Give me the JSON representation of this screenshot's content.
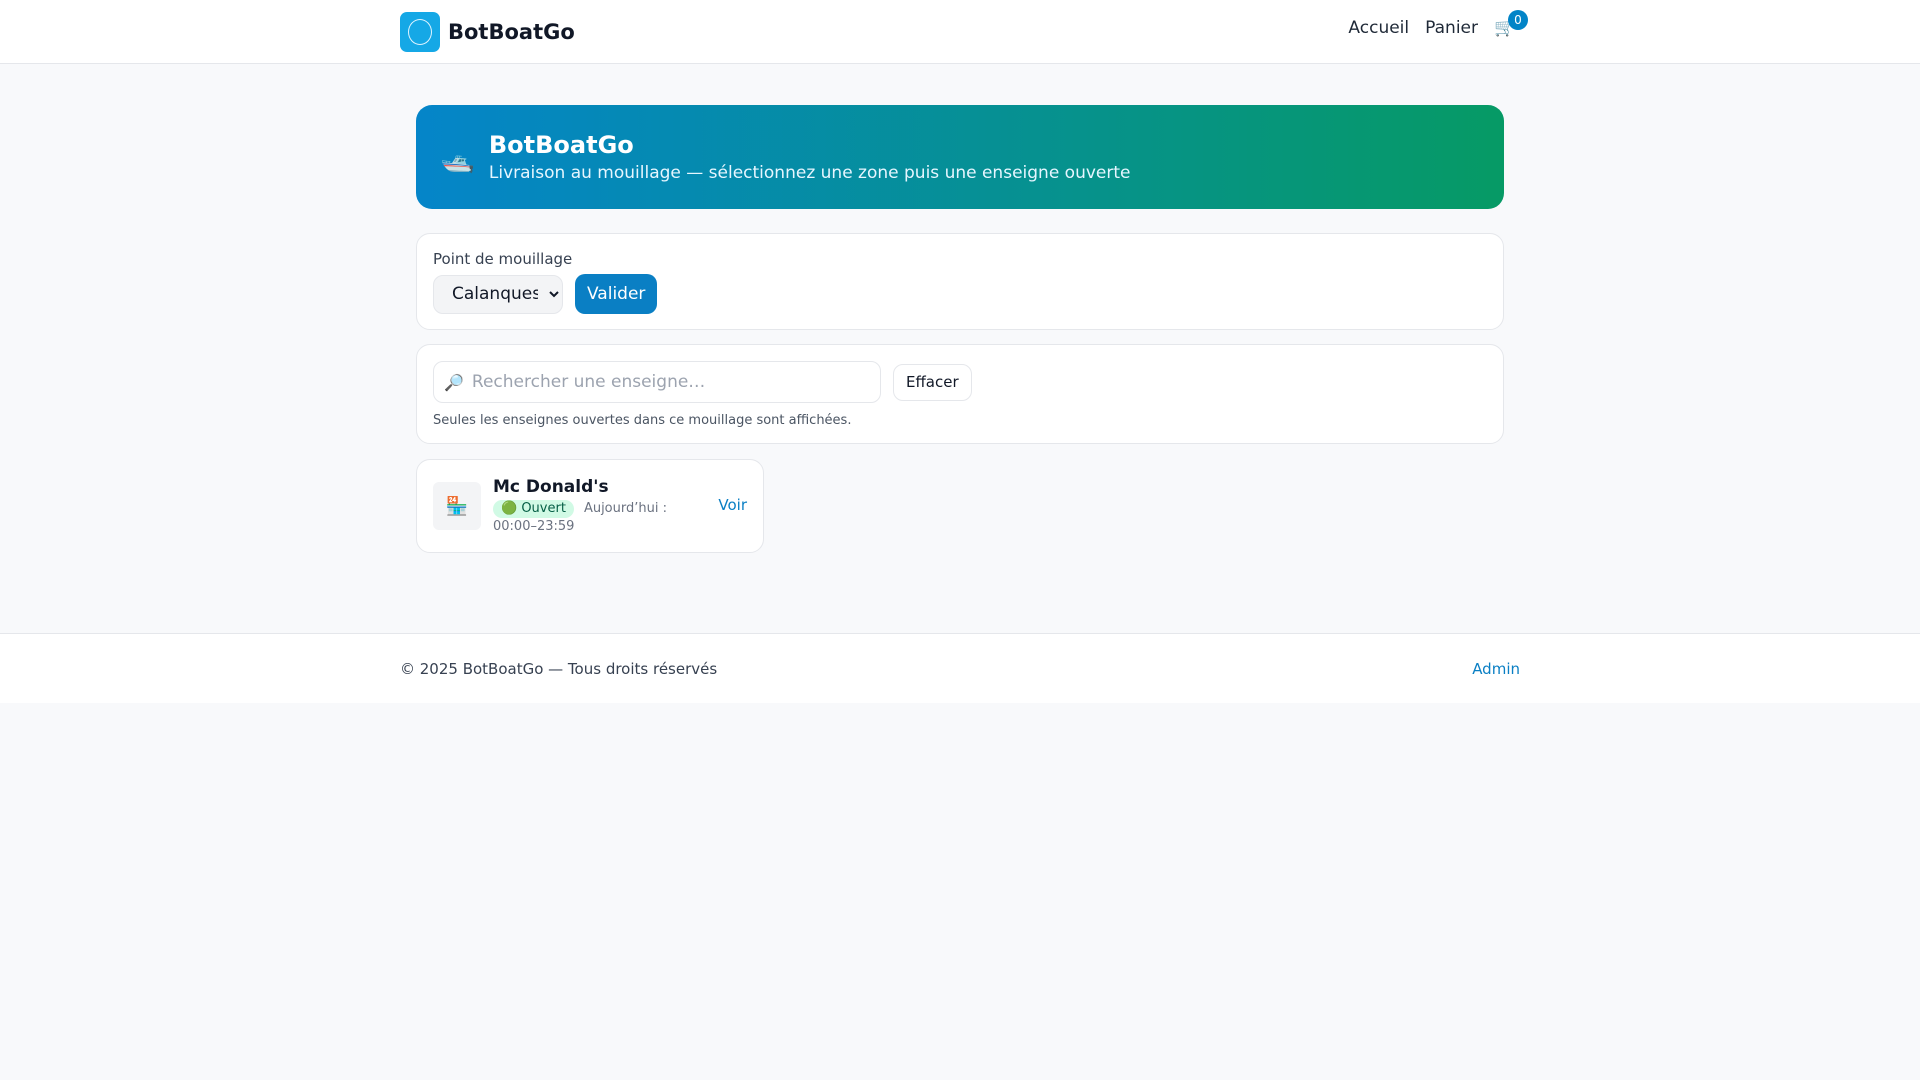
{
  "header": {
    "brand": "BotBoatGo",
    "nav": [
      "Accueil",
      "Panier"
    ],
    "cart_count": "0",
    "cart_icon": "🛒"
  },
  "hero": {
    "icon": "🛥️",
    "title": "BotBoatGo",
    "subtitle": "Livraison au mouillage — sélectionnez une zone puis une enseigne ouverte"
  },
  "mooring": {
    "label": "Point de mouillage",
    "selected": "Calanques",
    "submit": "Valider"
  },
  "search": {
    "icon": "🔎",
    "placeholder": "Rechercher une enseigne…",
    "clear": "Effacer",
    "hint": "Seules les enseignes ouvertes dans ce mouillage sont affichées."
  },
  "stores": [
    {
      "icon": "🏪",
      "name": "Mc Donald's",
      "status": "🟢 Ouvert",
      "hours": "Aujourd’hui : 00:00–23:59",
      "action": "Voir"
    }
  ],
  "footer": {
    "copyright": "© 2025 BotBoatGo — Tous droits réservés",
    "admin": "Admin"
  },
  "colors": {
    "accent": "#0a7fc4",
    "hero_start": "#0585c9",
    "hero_end": "#069a65"
  }
}
